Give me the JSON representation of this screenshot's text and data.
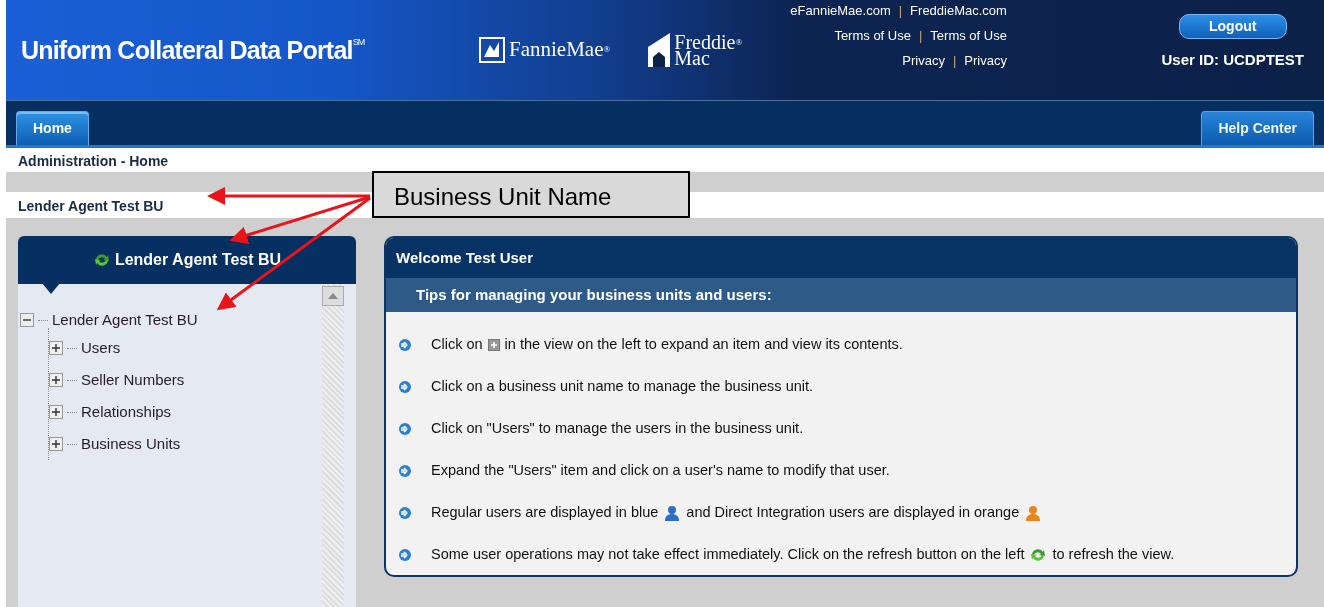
{
  "header": {
    "title": "Uniform Collateral Data Portal",
    "title_mark": "SM",
    "logos": [
      {
        "kind": "fannie",
        "text": "FannieMae",
        "mark": "®"
      },
      {
        "kind": "freddie",
        "text": "Freddie",
        "text2": "Mac",
        "mark": "®"
      }
    ],
    "links": [
      [
        "eFannieMae.com",
        "FreddieMac.com"
      ],
      [
        "Terms of Use",
        "Terms of Use"
      ],
      [
        "Privacy",
        "Privacy"
      ]
    ],
    "separator": "|",
    "logout": "Logout",
    "user_id": "User ID: UCDPTEST"
  },
  "tabs": [
    {
      "label": "Home",
      "selected": true
    },
    {
      "label": "Help Center",
      "selected": false
    }
  ],
  "breadcrumb": "Administration - Home",
  "business_unit": "Lender Agent Test BU",
  "annotation": "Business Unit Name",
  "panel": {
    "title": "Lender Agent Test BU",
    "tree": {
      "label": "Lender Agent Test BU",
      "expanded": true,
      "children": [
        {
          "label": "Users",
          "expanded": false
        },
        {
          "label": "Seller Numbers",
          "expanded": false
        },
        {
          "label": "Relationships",
          "expanded": false
        },
        {
          "label": "Business Units",
          "expanded": false
        }
      ]
    }
  },
  "welcome": {
    "title": "Welcome Test User",
    "subtitle": "Tips for managing your business units and users:",
    "tips": [
      {
        "parts": [
          {
            "kind": "text",
            "text": "Click on"
          },
          {
            "kind": "plus"
          },
          {
            "kind": "text",
            "text": "in the view on the left to expand an item and view its contents."
          }
        ]
      },
      {
        "parts": [
          {
            "kind": "text",
            "text": "Click on a business unit name to manage the business unit."
          }
        ]
      },
      {
        "parts": [
          {
            "kind": "text",
            "text": "Click on \"Users\" to manage the users in the business unit."
          }
        ]
      },
      {
        "parts": [
          {
            "kind": "text",
            "text": "Expand the \"Users\" item and click on a user's name to modify that user."
          }
        ]
      },
      {
        "parts": [
          {
            "kind": "text",
            "text": "Regular users are displayed in blue"
          },
          {
            "kind": "user",
            "color": "#2f6fc4"
          },
          {
            "kind": "text",
            "text": "and Direct Integration users are displayed in orange"
          },
          {
            "kind": "user",
            "color": "#e8861e"
          }
        ]
      },
      {
        "parts": [
          {
            "kind": "text",
            "text": "Some user operations may not take effect immediately. Click on the refresh button on the left"
          },
          {
            "kind": "refresh"
          },
          {
            "kind": "text",
            "text": "to refresh the view."
          }
        ]
      }
    ]
  }
}
